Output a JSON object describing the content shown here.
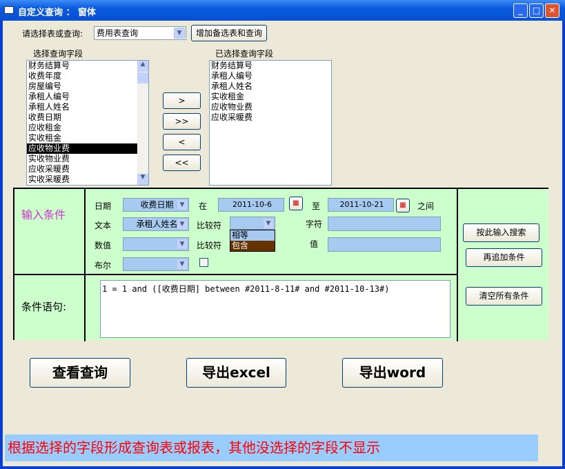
{
  "window": {
    "title": "自定义查询 ： 窗体",
    "minimize": "_",
    "maximize": "□",
    "close": "✕"
  },
  "top": {
    "table_label": "请选择表或查询:",
    "table_value": "费用表查询",
    "add_button": "增加备选表和查询"
  },
  "fields": {
    "available_label": "选择查询字段",
    "available": [
      "财务结算号",
      "收费年度",
      "房屋编号",
      "承租人编号",
      "承租人姓名",
      "收费日期",
      "应收租金",
      "实收租金",
      "应收物业费",
      "实收物业费",
      "应收采暖费",
      "实收采暖费"
    ],
    "selected_index": 8,
    "chosen_label": "已选择查询字段",
    "chosen": [
      "财务结算号",
      "承租人编号",
      "承租人姓名",
      "实收租金",
      "应收物业费",
      "应收采暖费"
    ]
  },
  "move_buttons": [
    ">",
    ">>",
    "<",
    "<<"
  ],
  "conditions": {
    "section_label": "输入条件",
    "date_label": "日期",
    "date_field": "收费日期",
    "at": "在",
    "date_from": "2011-10-6",
    "to": "至",
    "date_to": "2011-10-21",
    "between": "之间",
    "text_label": "文本",
    "text_field": "承租人姓名",
    "compare1": "比较符",
    "compare_options": [
      "相等",
      "包含"
    ],
    "compare_highlight": 1,
    "char_label": "字符",
    "number_label": "数值",
    "compare2": "比较符",
    "value_label": "值",
    "bool_label": "布尔",
    "search_button": "按此输入搜索",
    "add_condition_button": "再追加条件",
    "clear_button": "清空所有条件",
    "sentence_label": "条件语句:",
    "sentence": "1 = 1 and ([收费日期] between #2011-8-11# and #2011-10-13#)"
  },
  "actions": {
    "view": "查看查询",
    "excel": "导出excel",
    "word": "导出word"
  },
  "footer": "根据选择的字段形成查询表或报表，其他没选择的字段不显示",
  "colors": {
    "panel": "#ccffcc",
    "input": "#a6caf0",
    "accent_label": "#cc33cc",
    "footer_text": "#ff0000"
  }
}
